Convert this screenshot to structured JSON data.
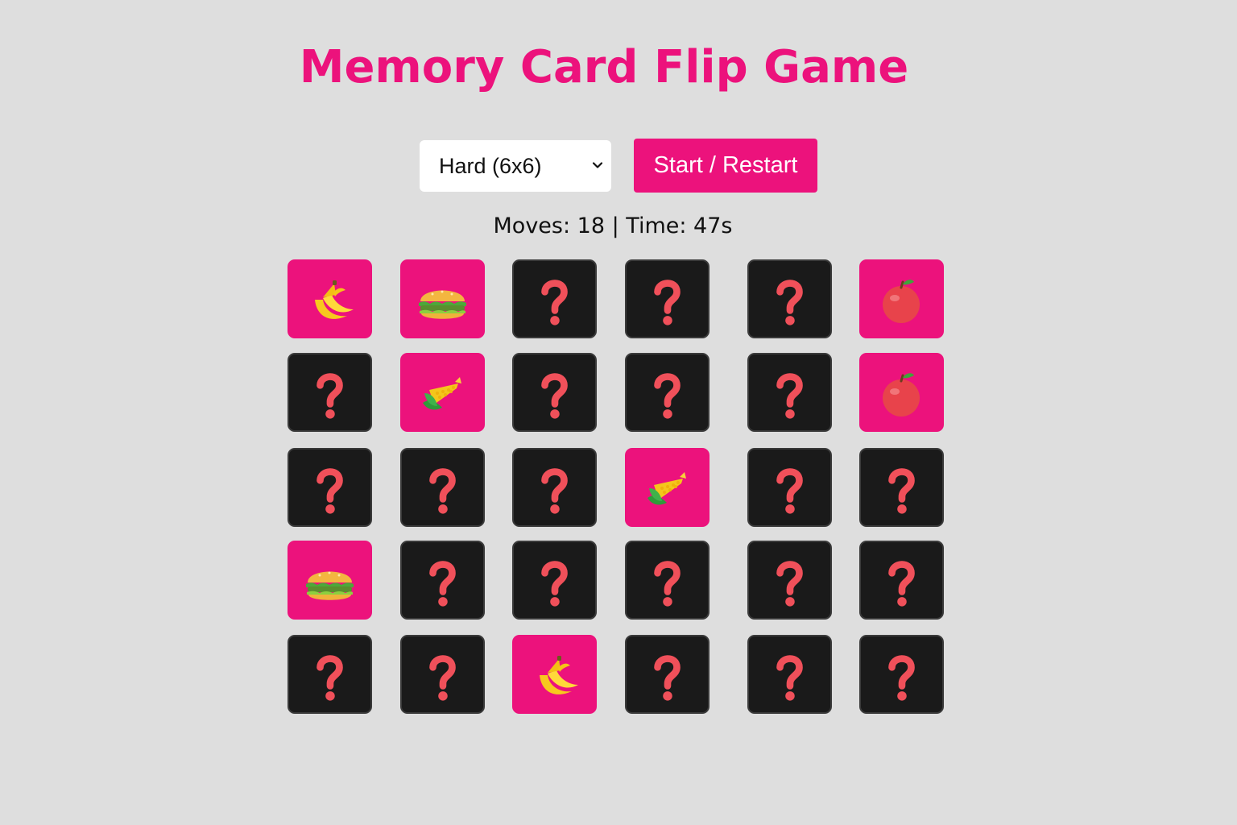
{
  "title": "Memory Card Flip Game",
  "controls": {
    "difficulty_selected": "Hard (6x6)",
    "start_label": "Start / Restart"
  },
  "stats": {
    "text": "Moves: 18 | Time: 47s",
    "moves": 18,
    "time_seconds": 47
  },
  "colors": {
    "accent": "#ec127c",
    "card_back": "#1a1a1a",
    "background": "#dedede"
  },
  "board": {
    "rows": [
      [
        "banana-icon",
        "hamburger-icon",
        "question-icon",
        "question-icon",
        "question-icon",
        "apple-icon"
      ],
      [
        "question-icon",
        "corn-icon",
        "question-icon",
        "question-icon",
        "question-icon",
        "apple-icon"
      ],
      [
        "question-icon",
        "question-icon",
        "question-icon",
        "corn-icon",
        "question-icon",
        "question-icon"
      ],
      [
        "hamburger-icon",
        "question-icon",
        "question-icon",
        "question-icon",
        "question-icon",
        "question-icon"
      ],
      [
        "question-icon",
        "question-icon",
        "banana-icon",
        "question-icon",
        "question-icon",
        "question-icon"
      ]
    ]
  }
}
